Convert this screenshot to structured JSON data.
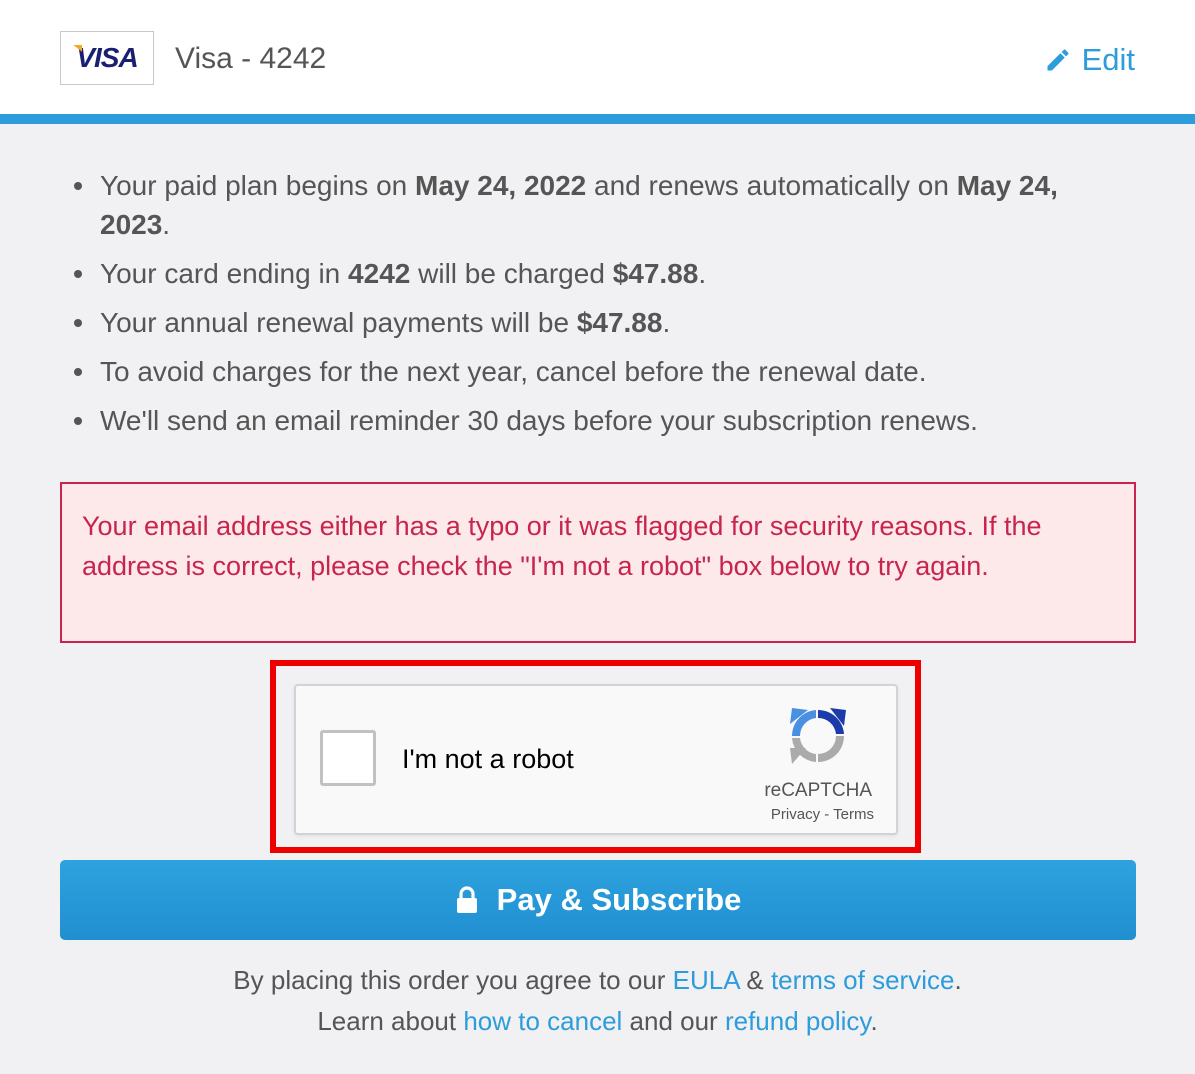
{
  "header": {
    "card_brand": "VISA",
    "card_label": "Visa - 4242",
    "edit_label": "Edit"
  },
  "terms": [
    {
      "parts": [
        "Your paid plan begins on ",
        "May 24, 2022",
        " and renews automatically on ",
        "May 24, 2023",
        "."
      ]
    },
    {
      "parts": [
        "Your card ending in ",
        "4242",
        " will be charged ",
        "$47.88",
        "."
      ]
    },
    {
      "parts": [
        "Your annual renewal payments will be ",
        "$47.88",
        "."
      ]
    },
    {
      "parts": [
        "To avoid charges for the next year, cancel before the renewal date."
      ]
    },
    {
      "parts": [
        "We'll send an email reminder 30 days before your subscription renews."
      ]
    }
  ],
  "error": {
    "message": "Your email address either has a typo or it was flagged for security reasons. If the address is correct, please check the \"I'm not a robot\" box below to try again."
  },
  "captcha": {
    "label": "I'm not a robot",
    "brand": "reCAPTCHA",
    "privacy": "Privacy",
    "separator": " - ",
    "terms": "Terms",
    "checked": false
  },
  "pay_button": {
    "label": "Pay & Subscribe",
    "icon": "lock-icon"
  },
  "footer": {
    "line1_prefix": "By placing this order you agree to our ",
    "eula": "EULA",
    "amp": " & ",
    "tos": "terms of service",
    "line1_suffix": ".",
    "line2_prefix": "Learn about ",
    "cancel": "how to cancel",
    "line2_mid": " and our ",
    "refund": "refund policy",
    "line2_suffix": "."
  },
  "colors": {
    "accent": "#2d9cdb",
    "error": "#c7254e",
    "error_bg": "#fde8ea",
    "highlight": "#ef0000"
  }
}
